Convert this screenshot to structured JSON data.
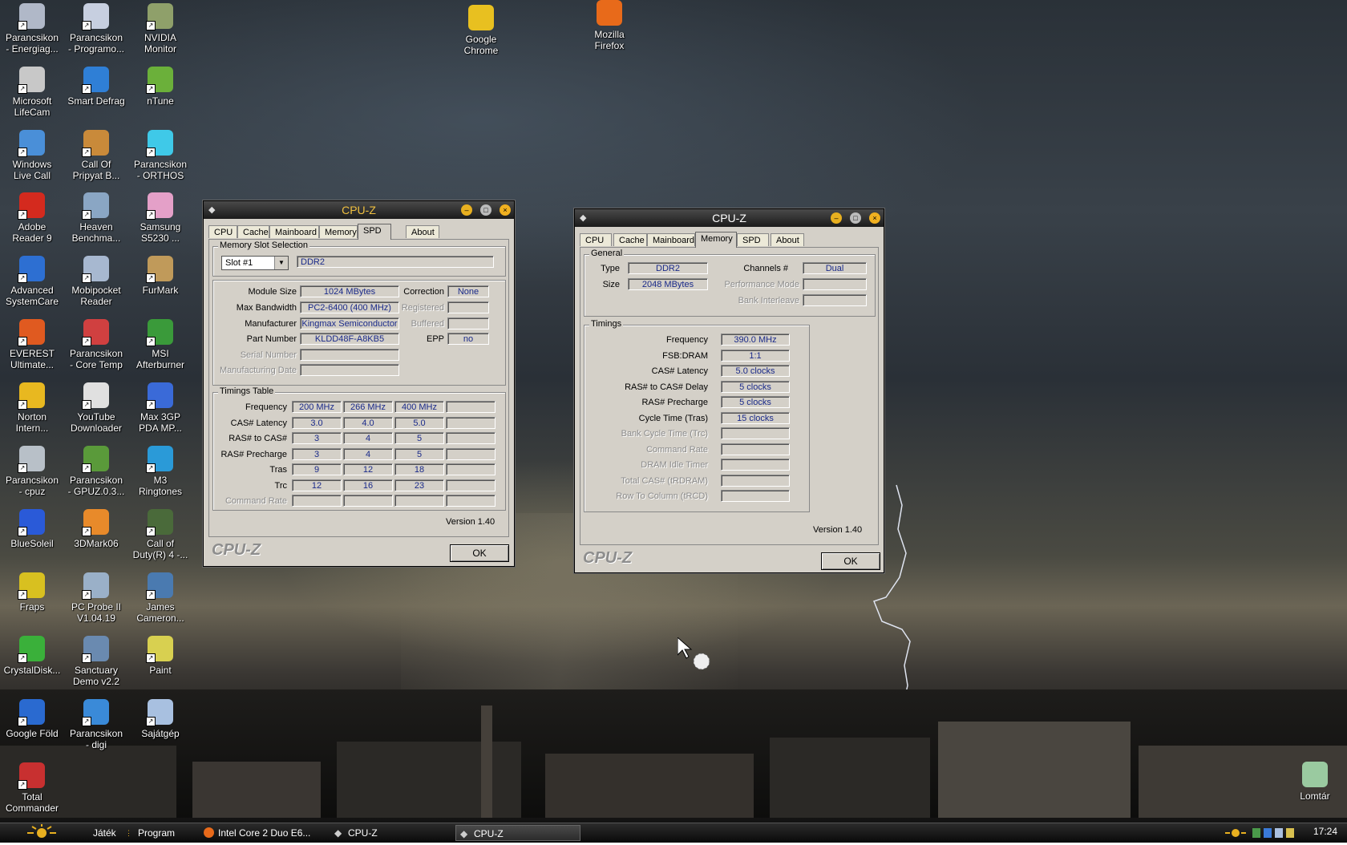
{
  "desktop": {
    "icons": [
      {
        "label1": "Parancsikon",
        "label2": "- Energiag...",
        "color": "#b0b8c8"
      },
      {
        "label1": "Parancsikon",
        "label2": "- Programo...",
        "color": "#c7cfe0"
      },
      {
        "label1": "NVIDIA",
        "label2": "Monitor",
        "color": "#8fa06a"
      },
      {
        "label1": "Microsoft",
        "label2": "LifeCam",
        "color": "#c8c8c8"
      },
      {
        "label1": "Smart Defrag",
        "label2": "",
        "color": "#2f7fd6"
      },
      {
        "label1": "nTune",
        "label2": "",
        "color": "#6bb03a"
      },
      {
        "label1": "Windows",
        "label2": "Live Call",
        "color": "#4a8fd8"
      },
      {
        "label1": "Call Of",
        "label2": "Pripyat B...",
        "color": "#c98a3a"
      },
      {
        "label1": "Parancsikon",
        "label2": "- ORTHOS",
        "color": "#3fc9e8"
      },
      {
        "label1": "Adobe",
        "label2": "Reader 9",
        "color": "#d42a1e"
      },
      {
        "label1": "Heaven",
        "label2": "Benchma...",
        "color": "#8aa6c4"
      },
      {
        "label1": "Samsung",
        "label2": "S5230 ...",
        "color": "#e4a0c8"
      },
      {
        "label1": "Advanced",
        "label2": "SystemCare",
        "color": "#2d6fd2"
      },
      {
        "label1": "Mobipocket",
        "label2": "Reader",
        "color": "#a7b8d0"
      },
      {
        "label1": "FurMark",
        "label2": "",
        "color": "#c09a5a"
      },
      {
        "label1": "EVEREST",
        "label2": "Ultimate...",
        "color": "#e05a20"
      },
      {
        "label1": "Parancsikon",
        "label2": "- Core Temp",
        "color": "#d04040"
      },
      {
        "label1": "MSI",
        "label2": "Afterburner",
        "color": "#3a9a3a"
      },
      {
        "label1": "Norton",
        "label2": "Intern...",
        "color": "#e8b820"
      },
      {
        "label1": "YouTube",
        "label2": "Downloader",
        "color": "#e0e0e0"
      },
      {
        "label1": "Max 3GP",
        "label2": "PDA MP...",
        "color": "#3a6ad8"
      },
      {
        "label1": "Parancsikon",
        "label2": "- cpuz",
        "color": "#b8c0c8"
      },
      {
        "label1": "Parancsikon",
        "label2": "- GPUZ.0.3...",
        "color": "#5a9a3a"
      },
      {
        "label1": "M3",
        "label2": "Ringtones",
        "color": "#2a9ad8"
      },
      {
        "label1": "BlueSoleil",
        "label2": "",
        "color": "#2a5ad8"
      },
      {
        "label1": "3DMark06",
        "label2": "",
        "color": "#e88a2a"
      },
      {
        "label1": "Call of",
        "label2": "Duty(R) 4 -...",
        "color": "#4a6a3a"
      },
      {
        "label1": "Fraps",
        "label2": "",
        "color": "#d8c020"
      },
      {
        "label1": "PC Probe II",
        "label2": "V1.04.19",
        "color": "#9ab0c8"
      },
      {
        "label1": "James",
        "label2": "Cameron...",
        "color": "#4a7ab0"
      },
      {
        "label1": "CrystalDisk...",
        "label2": "",
        "color": "#3ab03a"
      },
      {
        "label1": "Sanctuary",
        "label2": "Demo v2.2",
        "color": "#6a8ab0"
      },
      {
        "label1": "Paint",
        "label2": "",
        "color": "#d8d050"
      },
      {
        "label1": "Google Föld",
        "label2": "",
        "color": "#2a6ad0"
      },
      {
        "label1": "Parancsikon",
        "label2": "- digi",
        "color": "#3a8ad8"
      },
      {
        "label1": "Sajátgép",
        "label2": "",
        "color": "#a8c0e0"
      },
      {
        "label1": "Total",
        "label2": "Commander",
        "color": "#c83030"
      },
      {
        "label1": "Google",
        "label2": "Chrome",
        "color": "#e8c020"
      },
      {
        "label1": "Mozilla",
        "label2": "Firefox",
        "color": "#e86a1a"
      },
      {
        "label1": "Lomtár",
        "label2": "",
        "color": "#9acaa0"
      }
    ]
  },
  "window1": {
    "title": "CPU-Z",
    "tabs": [
      "CPU",
      "Cache",
      "Mainboard",
      "Memory",
      "SPD",
      "About"
    ],
    "active_tab": "SPD",
    "slot_group": "Memory Slot Selection",
    "slot_value": "Slot #1",
    "slot_type": "DDR2",
    "module_size_label": "Module Size",
    "module_size": "1024 MBytes",
    "max_bw_label": "Max Bandwidth",
    "max_bw": "PC2-6400 (400 MHz)",
    "manufacturer_label": "Manufacturer",
    "manufacturer": "Kingmax Semiconductor",
    "part_label": "Part Number",
    "part": "KLDD48F-A8KB5",
    "serial_label": "Serial Number",
    "mfg_date_label": "Manufacturing Date",
    "correction_label": "Correction",
    "correction": "None",
    "registered_label": "Registered",
    "buffered_label": "Buffered",
    "epp_label": "EPP",
    "epp": "no",
    "timings_group": "Timings Table",
    "timing_rows": [
      {
        "label": "Frequency",
        "v": [
          "200 MHz",
          "266 MHz",
          "400 MHz",
          ""
        ]
      },
      {
        "label": "CAS# Latency",
        "v": [
          "3.0",
          "4.0",
          "5.0",
          ""
        ]
      },
      {
        "label": "RAS# to CAS#",
        "v": [
          "3",
          "4",
          "5",
          ""
        ]
      },
      {
        "label": "RAS# Precharge",
        "v": [
          "3",
          "4",
          "5",
          ""
        ]
      },
      {
        "label": "Tras",
        "v": [
          "9",
          "12",
          "18",
          ""
        ]
      },
      {
        "label": "Trc",
        "v": [
          "12",
          "16",
          "23",
          ""
        ]
      },
      {
        "label": "Command Rate",
        "v": [
          "",
          "",
          "",
          ""
        ]
      }
    ],
    "version": "Version 1.40",
    "logo": "CPU-Z",
    "ok": "OK"
  },
  "window2": {
    "title": "CPU-Z",
    "tabs": [
      "CPU",
      "Cache",
      "Mainboard",
      "Memory",
      "SPD",
      "About"
    ],
    "active_tab": "Memory",
    "general_group": "General",
    "type_label": "Type",
    "type": "DDR2",
    "size_label": "Size",
    "size": "2048 MBytes",
    "channels_label": "Channels #",
    "channels": "Dual",
    "perf_mode_label": "Performance Mode",
    "bank_interleave_label": "Bank Interleave",
    "timings_group": "Timings",
    "timing_rows": [
      {
        "label": "Frequency",
        "v": "390.0 MHz",
        "dis": false
      },
      {
        "label": "FSB:DRAM",
        "v": "1:1",
        "dis": false
      },
      {
        "label": "CAS# Latency",
        "v": "5.0 clocks",
        "dis": false
      },
      {
        "label": "RAS# to CAS# Delay",
        "v": "5 clocks",
        "dis": false
      },
      {
        "label": "RAS# Precharge",
        "v": "5 clocks",
        "dis": false
      },
      {
        "label": "Cycle Time (Tras)",
        "v": "15 clocks",
        "dis": false
      },
      {
        "label": "Bank Cycle Time (Trc)",
        "v": "",
        "dis": true
      },
      {
        "label": "Command Rate",
        "v": "",
        "dis": true
      },
      {
        "label": "DRAM Idle Timer",
        "v": "",
        "dis": true
      },
      {
        "label": "Total CAS# (tRDRAM)",
        "v": "",
        "dis": true
      },
      {
        "label": "Row To Column (tRCD)",
        "v": "",
        "dis": true
      }
    ],
    "version": "Version 1.40",
    "logo": "CPU-Z",
    "ok": "OK"
  },
  "taskbar": {
    "ql1": "Játék",
    "ql2": "Program",
    "btn1": "Intel Core 2 Duo E6...",
    "btn2": "CPU-Z",
    "btn3": "CPU-Z",
    "clock": "17:24"
  }
}
